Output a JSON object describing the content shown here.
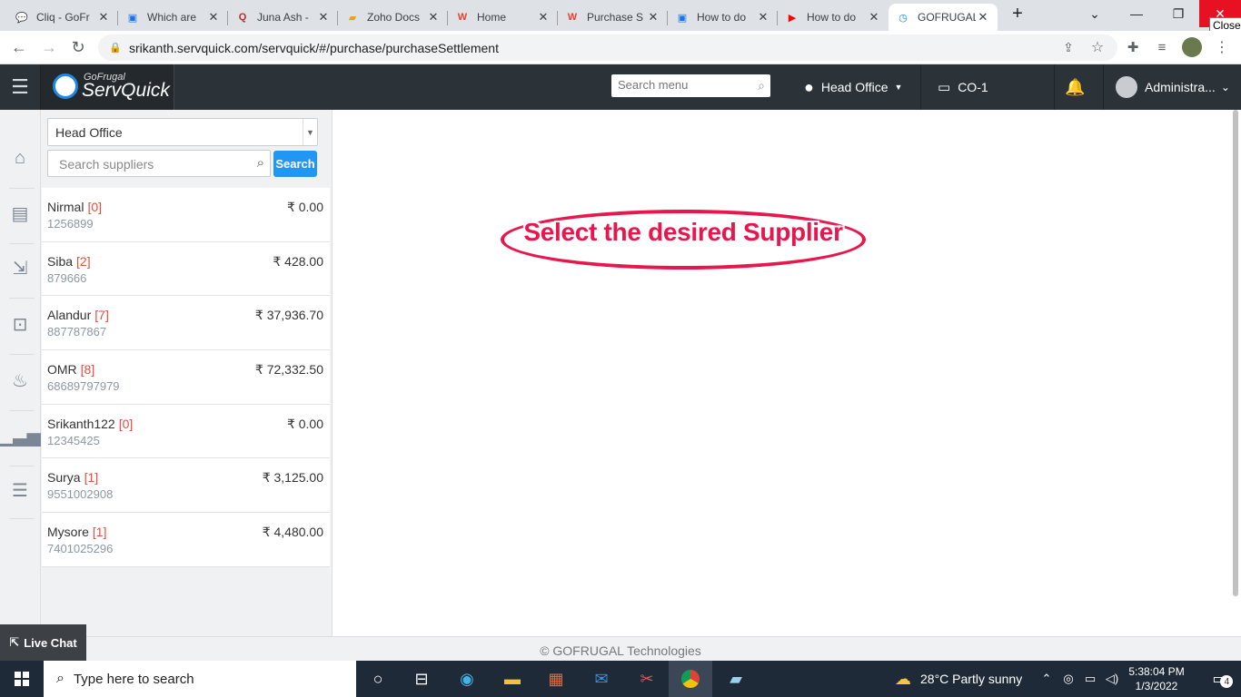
{
  "browser": {
    "tabs": [
      {
        "label": "Cliq - GoFr",
        "icon": "cliq-icon",
        "color": "#1a73e8"
      },
      {
        "label": "Which are",
        "icon": "doc-icon",
        "color": "#1a73e8"
      },
      {
        "label": "Juna Ash -",
        "icon": "quora-icon",
        "color": "#b92b27"
      },
      {
        "label": "Zoho Docs",
        "icon": "folder-icon",
        "color": "#e8a317"
      },
      {
        "label": "Home",
        "icon": "w-icon",
        "color": "#e8412c"
      },
      {
        "label": "Purchase S",
        "icon": "w-icon",
        "color": "#e8412c"
      },
      {
        "label": "How to do",
        "icon": "doc-icon",
        "color": "#1a73e8"
      },
      {
        "label": "How to do",
        "icon": "youtube-icon",
        "color": "#ff0000"
      },
      {
        "label": "GOFRUGAL",
        "icon": "gofrugal-icon",
        "color": "#1e88e5"
      }
    ],
    "new_tab": "+",
    "close_tooltip": "Close",
    "url": "srikanth.servquick.com/servquick/#/purchase/purchaseSettlement"
  },
  "app": {
    "logo_top": "GoFrugal",
    "logo_main": "ServQuick",
    "menu_search_placeholder": "Search menu",
    "location": "Head Office",
    "counter": "CO-1",
    "user": "Administra..."
  },
  "panel": {
    "branch": "Head Office",
    "search_placeholder": "Search suppliers",
    "search_button": "Search",
    "suppliers": [
      {
        "name": "Nirmal",
        "count": "[0]",
        "phone": "1256899",
        "amount": "₹ 0.00"
      },
      {
        "name": "Siba",
        "count": "[2]",
        "phone": "879666",
        "amount": "₹ 428.00"
      },
      {
        "name": "Alandur",
        "count": "[7]",
        "phone": "887787867",
        "amount": "₹ 37,936.70"
      },
      {
        "name": "OMR",
        "count": "[8]",
        "phone": "68689797979",
        "amount": "₹ 72,332.50"
      },
      {
        "name": "Srikanth122",
        "count": "[0]",
        "phone": "12345425",
        "amount": "₹ 0.00"
      },
      {
        "name": "Surya",
        "count": "[1]",
        "phone": "9551002908",
        "amount": "₹ 3,125.00"
      },
      {
        "name": "Mysore",
        "count": "[1]",
        "phone": "7401025296",
        "amount": "₹ 4,480.00"
      }
    ]
  },
  "main": {
    "hint": "Select the desired Supplier"
  },
  "footer": {
    "copyright": "© GOFRUGAL Technologies",
    "live_chat": "Live Chat"
  },
  "taskbar": {
    "search_placeholder": "Type here to search",
    "weather": "28°C  Partly sunny",
    "time": "5:38:04 PM",
    "date": "1/3/2022",
    "notifications": "4"
  },
  "colors": {
    "accent": "#2196f3",
    "header": "#2c3338",
    "hint": "#e8164c",
    "count": "#e74c3c"
  }
}
